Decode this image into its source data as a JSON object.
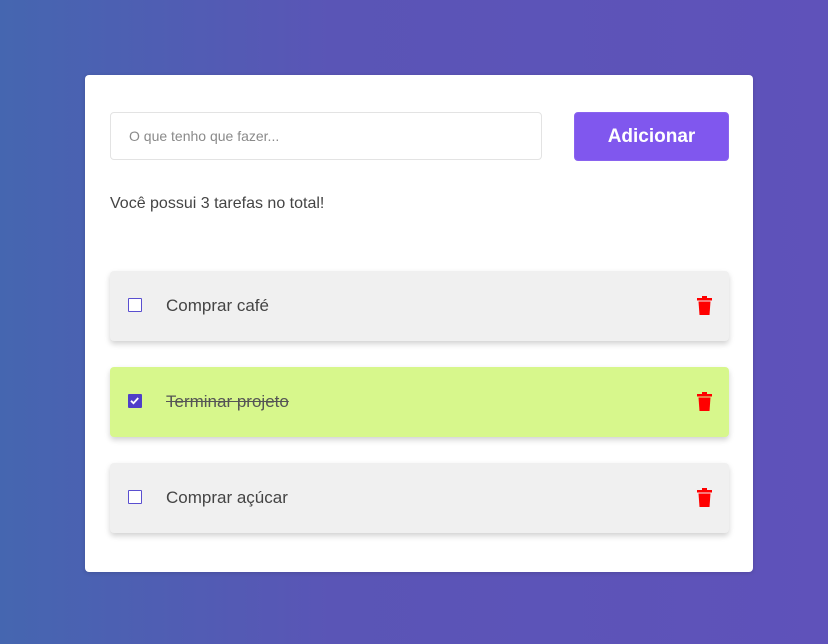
{
  "form": {
    "input_value": "",
    "input_placeholder": "O que tenho que fazer...",
    "add_label": "Adicionar"
  },
  "summary": "Você possui 3 tarefas no total!",
  "tasks": [
    {
      "label": "Comprar café",
      "done": false
    },
    {
      "label": "Terminar projeto",
      "done": true
    },
    {
      "label": "Comprar açúcar",
      "done": false
    }
  ],
  "icons": {
    "checkbox": "checkbox-icon",
    "delete": "trash-icon"
  },
  "colors": {
    "accent": "#8057ee",
    "done_background": "#d7f78c",
    "pending_background": "#f0f0f0",
    "delete": "#ff0000",
    "checkbox": "#4f3fc9"
  }
}
